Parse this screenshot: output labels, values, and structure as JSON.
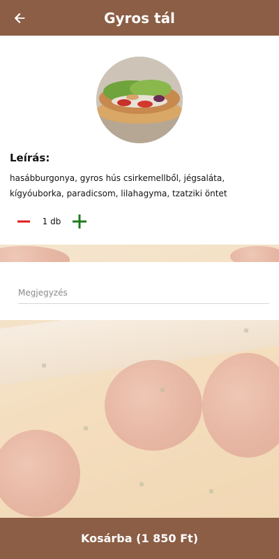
{
  "header": {
    "title": "Gyros tál",
    "back_icon": "arrow-left-icon"
  },
  "product": {
    "image_icon": "gyros-plate-photo",
    "description_label": "Leírás:",
    "description": "hasábburgonya, gyros hús csirkemellből, jégsaláta, kígyóuborka, paradicsom, lilahagyma, tzatziki öntet"
  },
  "quantity": {
    "minus_icon": "minus-icon",
    "value": "1 db",
    "plus_icon": "plus-icon"
  },
  "note": {
    "placeholder": "Megjegyzés",
    "value": ""
  },
  "footer": {
    "add_to_cart_label": "Kosárba (1 850 Ft)"
  },
  "colors": {
    "brand": "#8b5e45",
    "minus": "#e01b1b",
    "plus": "#1e7a1e"
  }
}
